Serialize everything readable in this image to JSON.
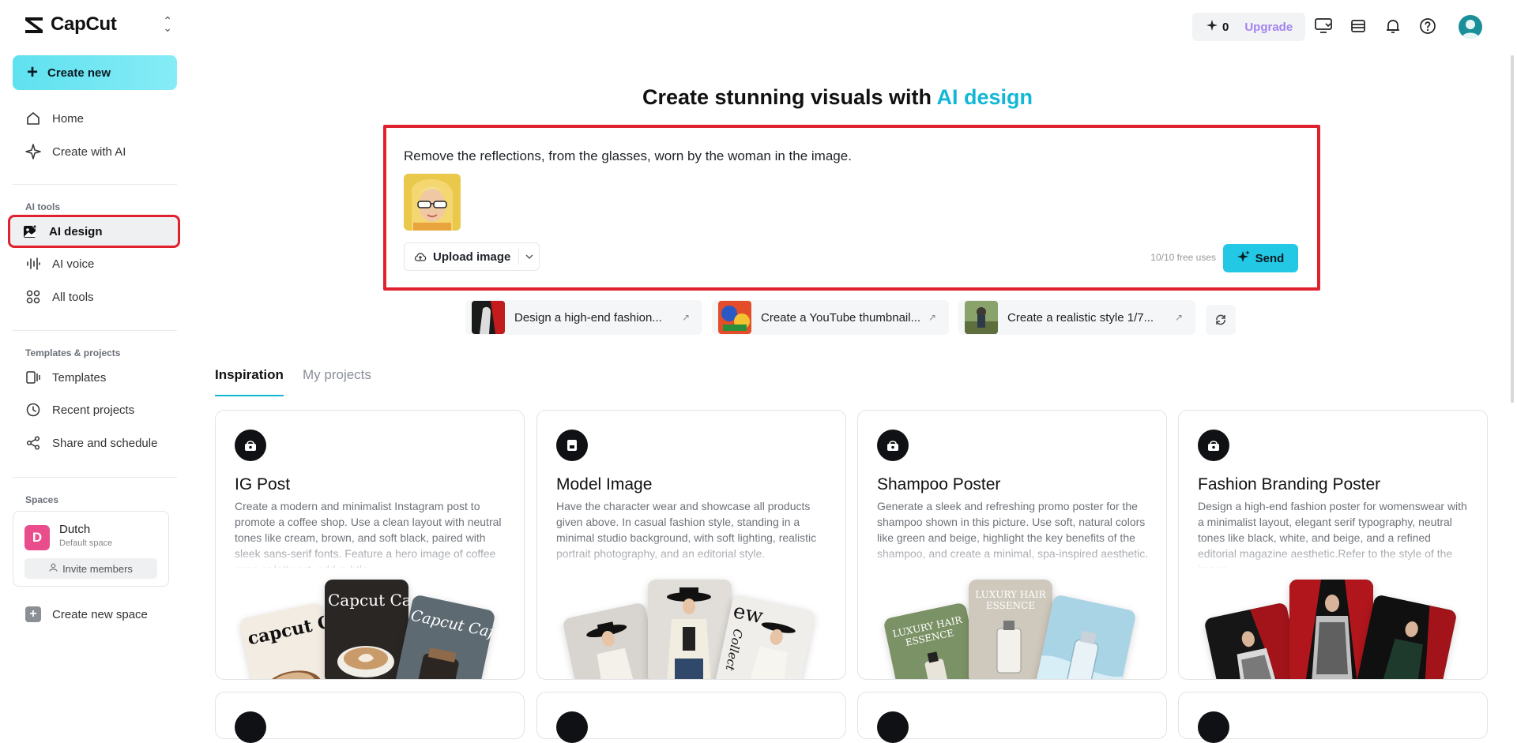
{
  "app": {
    "name": "CapCut"
  },
  "sidebar": {
    "create_new": "Create new",
    "items": [
      {
        "label": "Home",
        "icon": "home-icon"
      },
      {
        "label": "Create with AI",
        "icon": "sparkle-icon"
      }
    ],
    "ai_tools_label": "AI tools",
    "ai_tools": [
      {
        "label": "AI design",
        "icon": "ai-design-icon",
        "active": true
      },
      {
        "label": "AI voice",
        "icon": "waveform-icon"
      },
      {
        "label": "All tools",
        "icon": "grid-icon"
      }
    ],
    "templates_label": "Templates & projects",
    "templates": [
      {
        "label": "Templates",
        "icon": "templates-icon"
      },
      {
        "label": "Recent projects",
        "icon": "clock-icon"
      },
      {
        "label": "Share and schedule",
        "icon": "share-icon"
      }
    ],
    "spaces_label": "Spaces",
    "space": {
      "initial": "D",
      "name": "Dutch",
      "subtitle": "Default space",
      "invite": "Invite members"
    },
    "create_space": "Create new space"
  },
  "topbar": {
    "credits": "0",
    "upgrade": "Upgrade"
  },
  "hero": {
    "title_prefix": "Create stunning visuals with ",
    "title_accent": "AI design"
  },
  "prompt": {
    "text": "Remove the reflections, from the glasses, worn by the woman in the image.",
    "upload_label": "Upload image",
    "free_uses": "10/10 free uses",
    "send_label": "Send"
  },
  "suggestions": [
    {
      "label": "Design a high-end fashion..."
    },
    {
      "label": "Create a YouTube thumbnail..."
    },
    {
      "label": "Create a realistic style 1/7..."
    }
  ],
  "tabs": {
    "active": "Inspiration",
    "other": "My projects"
  },
  "cards": [
    {
      "title": "IG Post",
      "desc": "Create a modern and minimalist Instagram post to promote a coffee shop. Use a clean layout with neutral tones like cream, brown, and soft black, paired with sleek sans-serif fonts. Feature a hero image of coffee cups or latte art, add subtle",
      "thumbs": [
        "capcut C",
        "Capcut Ca",
        "Capcut Cafe"
      ]
    },
    {
      "title": "Model Image",
      "desc": "Have the character wear and showcase all products given above. In casual fashion style, standing in a minimal studio background, with soft lighting, realistic portrait photography, and an editorial style.",
      "thumbs": [
        "ew",
        "Collect"
      ]
    },
    {
      "title": "Shampoo Poster",
      "desc": "Generate a sleek and refreshing promo poster for the shampoo shown in this picture. Use soft, natural colors like green and beige, highlight the key benefits of the shampoo, and create a minimal, spa-inspired aesthetic.",
      "thumbs": [
        "LUXURY HAIR ESSENCE",
        "LUXURY HAIR ESSENCE"
      ]
    },
    {
      "title": "Fashion Branding Poster",
      "desc": "Design a high-end fashion poster for womenswear with a minimalist layout, elegant serif typography, neutral tones like black, white, and beige, and a refined editorial magazine aesthetic.Refer to the style of the image.",
      "thumbs": []
    }
  ],
  "colors": {
    "accent": "#13b7d6",
    "highlight": "#e0222e",
    "send": "#23c8e5",
    "upgrade": "#a383f0"
  }
}
